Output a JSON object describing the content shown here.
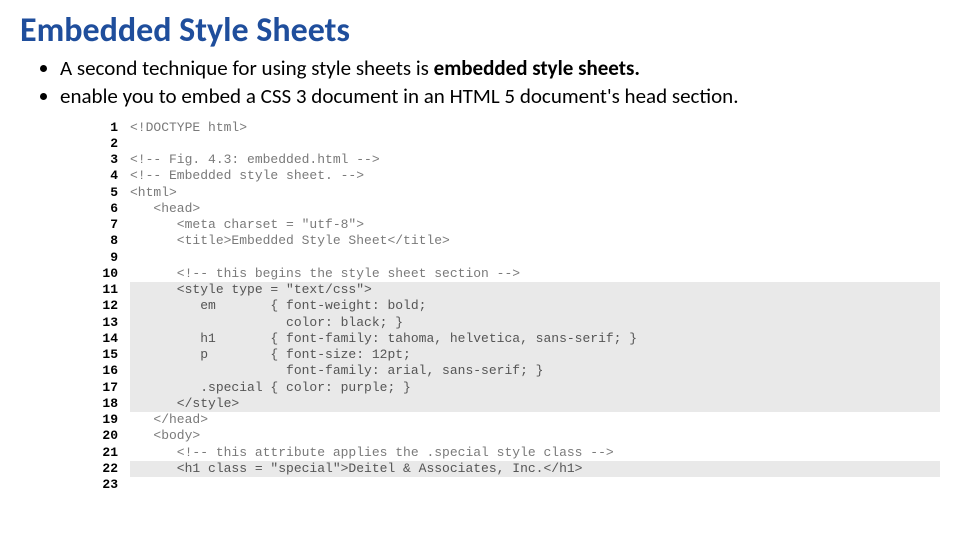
{
  "title": "Embedded Style Sheets",
  "bullet1_a": "A second technique for using style sheets is ",
  "bullet1_b": "embedded style sheets.",
  "bullet2_a": "enable you to embed a CSS 3 document in an HTML 5 document's head section.",
  "code": {
    "l1": "<!DOCTYPE html>",
    "l2": "",
    "l3": "<!-- Fig. 4.3: embedded.html -->",
    "l4": "<!-- Embedded style sheet. -->",
    "l5": "<html>",
    "l6": "   <head>",
    "l7": "      <meta charset = \"utf-8\">",
    "l8": "      <title>Embedded Style Sheet</title>",
    "l9": "",
    "l10": "      <!-- this begins the style sheet section -->",
    "l11": "      <style type = \"text/css\">",
    "l12": "         em       { font-weight: bold;",
    "l13": "                    color: black; }",
    "l14": "         h1       { font-family: tahoma, helvetica, sans-serif; }",
    "l15": "         p        { font-size: 12pt;",
    "l16": "                    font-family: arial, sans-serif; }",
    "l17": "         .special { color: purple; }",
    "l18": "      </style>",
    "l19": "   </head>",
    "l20": "   <body>",
    "l21": "      <!-- this attribute applies the .special style class -->",
    "l22": "      <h1 class = \"special\">Deitel & Associates, Inc.</h1>",
    "l23": ""
  }
}
